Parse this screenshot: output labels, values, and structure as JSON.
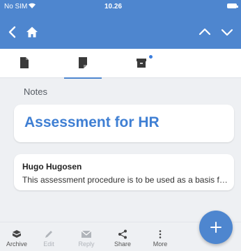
{
  "status_bar": {
    "carrier": "No SIM",
    "time": "10.26",
    "wifi_icon": "wifi-icon",
    "battery_icon": "battery-icon"
  },
  "nav": {
    "back_icon": "chevron-left-icon",
    "home_icon": "home-icon",
    "prev_icon": "chevron-up-icon",
    "next_icon": "chevron-down-icon"
  },
  "tabs": [
    {
      "icon": "document-icon",
      "active": false
    },
    {
      "icon": "note-icon",
      "active": true
    },
    {
      "icon": "archive-box-icon",
      "active": false,
      "badge": true
    }
  ],
  "section": {
    "label": "Notes"
  },
  "note": {
    "title": "Assessment for HR",
    "author": "Hugo Hugosen",
    "preview": "This assessment procedure is to be used as a basis for evaluating"
  },
  "toolbar": {
    "items": [
      {
        "label": "Archive",
        "icon": "archive-icon",
        "enabled": true
      },
      {
        "label": "Edit",
        "icon": "pencil-icon",
        "enabled": false
      },
      {
        "label": "Reply",
        "icon": "envelope-icon",
        "enabled": false
      },
      {
        "label": "Share",
        "icon": "share-icon",
        "enabled": true
      },
      {
        "label": "More",
        "icon": "more-vertical-icon",
        "enabled": true
      }
    ],
    "fab_icon": "plus-icon"
  },
  "colors": {
    "primary": "#4e86cf",
    "title": "#3f7fd3",
    "background": "#eef0f3"
  }
}
